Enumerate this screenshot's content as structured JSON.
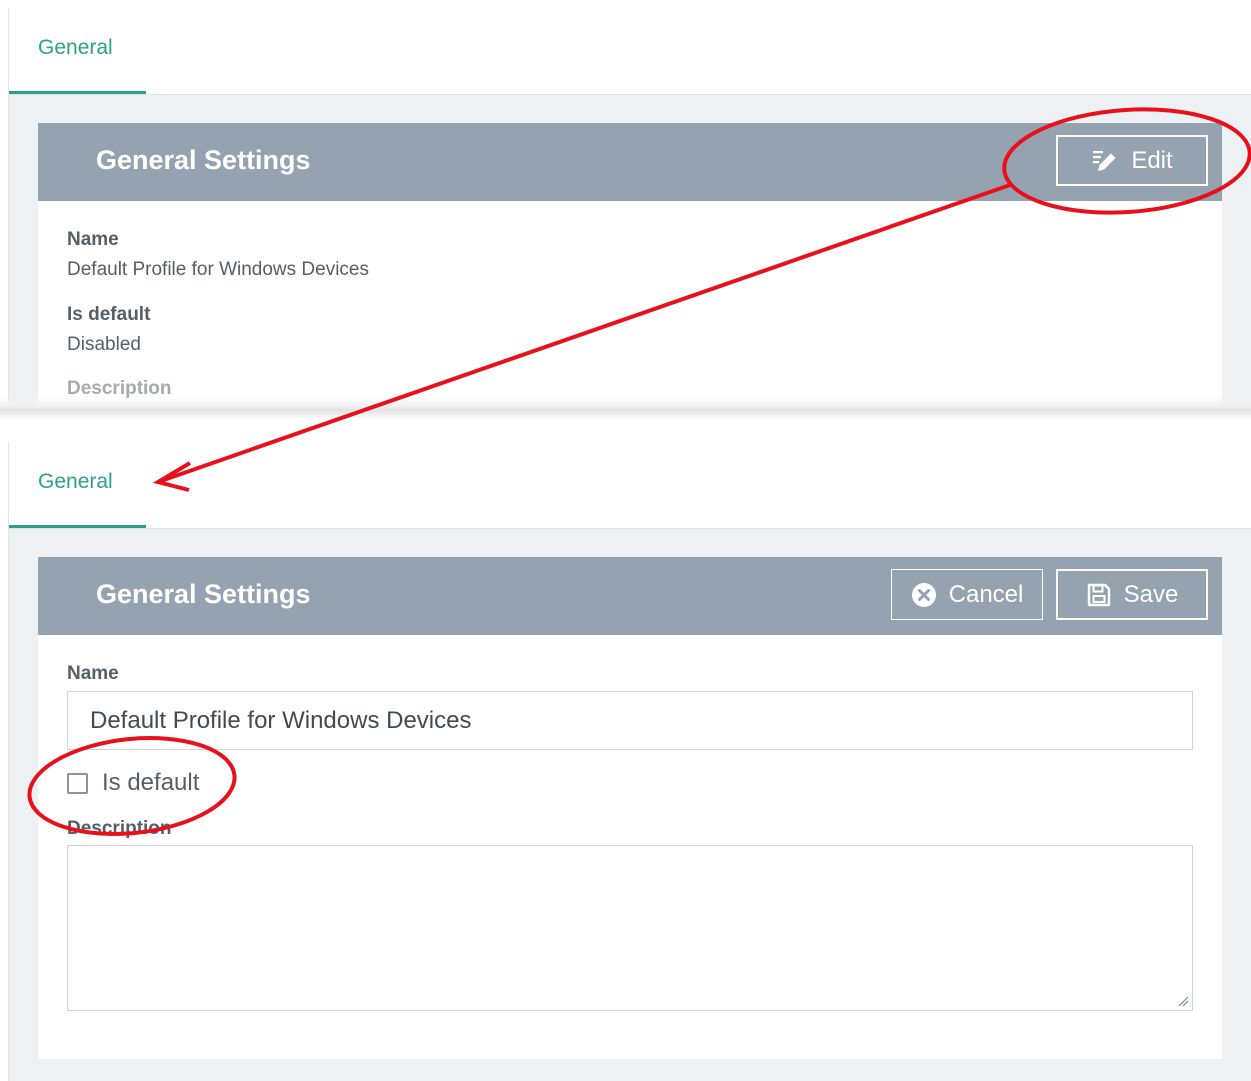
{
  "top_view": {
    "tab_label": "General",
    "card_title": "General Settings",
    "edit_label": "Edit",
    "fields": [
      {
        "label": "Name",
        "value": "Default Profile for Windows Devices"
      },
      {
        "label": "Is default",
        "value": "Disabled"
      },
      {
        "label": "Description",
        "value": ""
      }
    ]
  },
  "bottom_view": {
    "tab_label": "General",
    "card_title": "General Settings",
    "cancel_label": "Cancel",
    "save_label": "Save",
    "name_label": "Name",
    "name_value": "Default Profile for Windows Devices",
    "is_default_label": "Is default",
    "is_default_checked": false,
    "description_label": "Description",
    "description_value": ""
  },
  "colors": {
    "accent": "#2ba287",
    "header_bg": "#95a3b1",
    "page_bg": "#eef1f4",
    "annotation": "#e8111b"
  },
  "icons": [
    "edit-pencil-icon",
    "cancel-x-circle-icon",
    "save-floppy-icon",
    "resize-grip-icon"
  ]
}
